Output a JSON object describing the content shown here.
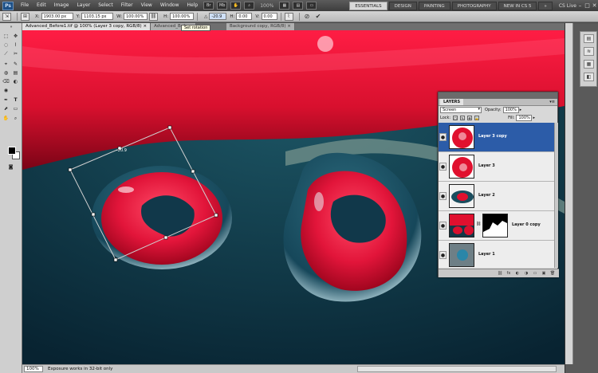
{
  "app": {
    "logo": "Ps",
    "menu": [
      "File",
      "Edit",
      "Image",
      "Layer",
      "Select",
      "Filter",
      "View",
      "Window",
      "Help"
    ],
    "zoom": "100%",
    "workspaces": [
      "ESSENTIALS",
      "DESIGN",
      "PAINTING",
      "PHOTOGRAPHY",
      "NEW IN CS 5"
    ],
    "workspace_more": "»",
    "cs_live": "CS Live",
    "window_controls": [
      "–",
      "□",
      "✕"
    ]
  },
  "options": {
    "x_label": "X:",
    "x_value": "1903.00 px",
    "y_label": "Y:",
    "y_value": "1103.15 px",
    "w_label": "W:",
    "w_value": "100.00%",
    "h_label": "H:",
    "h_value": "100.00%",
    "angle_label": "△",
    "angle_value": "-20.9",
    "hskew_label": "H:",
    "hskew_value": "0.00",
    "vskew_label": "V:",
    "vskew_value": "0.00",
    "cancel_icon": "⊘",
    "commit_icon": "✔"
  },
  "documents": {
    "tabs": [
      "Advanced_Before1.tif @ 100% (Layer 3 copy, RGB/8)",
      "Advanced_Before",
      "Background copy, RGB/8)"
    ],
    "close_glyph": "×",
    "tooltip": "Set rotation"
  },
  "tools": [
    "⬚",
    "✥",
    "◌",
    "⌇",
    "⟋",
    "✂",
    "⌖",
    "✎",
    "◍",
    "▤",
    "⌫",
    "◐",
    "◉",
    "✒",
    "T",
    "⬈",
    "▭",
    "✋",
    "⌕"
  ],
  "status": {
    "zoom": "100%",
    "info": "Exposure works in 32-bit only"
  },
  "dock": {
    "icons": [
      "▤",
      "≋",
      "▦",
      "◧"
    ]
  },
  "layers_panel": {
    "tab": "LAYERS",
    "menu_glyph": "▾≡",
    "blend_mode": "Screen",
    "opacity_label": "Opacity:",
    "opacity_value": "100%",
    "lock_label": "Lock:",
    "lock_icons": [
      "▢",
      "✎",
      "✥",
      "🔒"
    ],
    "fill_label": "Fill:",
    "fill_value": "100%",
    "arrow": "▸",
    "eye_glyph": "●",
    "link_glyph": "⛓",
    "layers": [
      {
        "name": "Layer 3 copy",
        "selected": true
      },
      {
        "name": "Layer 3",
        "selected": false
      },
      {
        "name": "Layer 2",
        "selected": false
      },
      {
        "name": "Layer 0 copy",
        "selected": false
      },
      {
        "name": "Layer 1",
        "selected": false
      }
    ],
    "footer_icons": [
      "⛓",
      "fx",
      "◐",
      "◑",
      "▭",
      "▣",
      "🗑"
    ]
  },
  "colors": {
    "accent_selected": "#2c5ca8",
    "petal_red": "#e0102e",
    "water_teal": "#123847"
  }
}
